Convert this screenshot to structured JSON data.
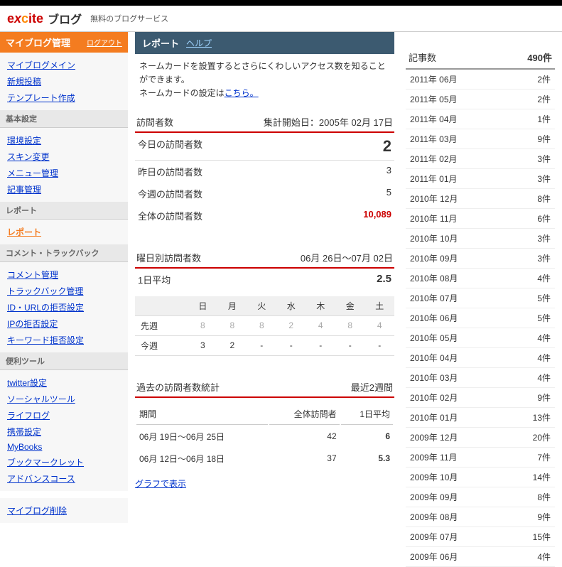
{
  "header": {
    "logo_prefix": "e",
    "logo_x": "x",
    "logo_c": "c",
    "logo_suffix": "ite",
    "logo_blog": "ブログ",
    "tagline": "無料のブログサービス"
  },
  "sidebar": {
    "title": "マイブログ管理",
    "logout": "ログアウト",
    "main_links": [
      "マイブログメイン",
      "新規投稿",
      "テンプレート作成"
    ],
    "sections": [
      {
        "title": "基本設定",
        "links": [
          "環境設定",
          "スキン変更",
          "メニュー管理",
          "記事管理"
        ]
      },
      {
        "title": "レポート",
        "links": [
          "レポート"
        ],
        "current": 0
      },
      {
        "title": "コメント・トラックバック",
        "links": [
          "コメント管理",
          "トラックバック管理",
          "ID・URLの拒否設定",
          "IPの拒否設定",
          "キーワード拒否設定"
        ]
      },
      {
        "title": "便利ツール",
        "links": [
          "twitter設定",
          "ソーシャルツール",
          "ライフログ",
          "携帯設定",
          "MyBooks",
          "ブックマークレット",
          "アドバンスコース"
        ]
      }
    ],
    "delete_link": "マイブログ削除"
  },
  "report": {
    "title": "レポート",
    "help": "ヘルプ",
    "intro_line1": "ネームカードを設置するとさらにくわしいアクセス数を知ることができます。",
    "intro_line2_pre": "ネームカードの設定は",
    "intro_link": "こちら。",
    "visitors": {
      "label": "訪問者数",
      "start_date": "集計開始日：2005年 02月 17日",
      "today_label": "今日の訪問者数",
      "today_value": "2",
      "rows": [
        {
          "label": "昨日の訪問者数",
          "value": "3"
        },
        {
          "label": "今週の訪問者数",
          "value": "5"
        },
        {
          "label": "全体の訪問者数",
          "value": "10,089",
          "red": true
        }
      ]
    },
    "weekday": {
      "label": "曜日別訪問者数",
      "range": "06月 26日〜07月 02日",
      "avg_label": "1日平均",
      "avg_value": "2.5",
      "headers": [
        "日",
        "月",
        "火",
        "水",
        "木",
        "金",
        "土"
      ],
      "rows": [
        {
          "label": "先週",
          "values": [
            "8",
            "8",
            "8",
            "2",
            "4",
            "8",
            "4"
          ],
          "dim": true
        },
        {
          "label": "今週",
          "values": [
            "3",
            "2",
            "-",
            "-",
            "-",
            "-",
            "-"
          ]
        }
      ]
    },
    "past": {
      "label": "過去の訪問者数統計",
      "range": "最近2週間",
      "cols": [
        "期間",
        "全体訪問者",
        "1日平均"
      ],
      "rows": [
        {
          "period": "06月 19日〜06月 25日",
          "total": "42",
          "avg": "6"
        },
        {
          "period": "06月 12日〜06月 18日",
          "total": "37",
          "avg": "5.3"
        }
      ],
      "graph_link": "グラフで表示"
    }
  },
  "archive": {
    "label": "記事数",
    "total": "490件",
    "rows": [
      {
        "month": "2011年 06月",
        "count": "2件"
      },
      {
        "month": "2011年 05月",
        "count": "2件"
      },
      {
        "month": "2011年 04月",
        "count": "1件"
      },
      {
        "month": "2011年 03月",
        "count": "9件"
      },
      {
        "month": "2011年 02月",
        "count": "3件"
      },
      {
        "month": "2011年 01月",
        "count": "3件"
      },
      {
        "month": "2010年 12月",
        "count": "8件"
      },
      {
        "month": "2010年 11月",
        "count": "6件"
      },
      {
        "month": "2010年 10月",
        "count": "3件"
      },
      {
        "month": "2010年 09月",
        "count": "3件"
      },
      {
        "month": "2010年 08月",
        "count": "4件"
      },
      {
        "month": "2010年 07月",
        "count": "5件"
      },
      {
        "month": "2010年 06月",
        "count": "5件"
      },
      {
        "month": "2010年 05月",
        "count": "4件"
      },
      {
        "month": "2010年 04月",
        "count": "4件"
      },
      {
        "month": "2010年 03月",
        "count": "4件"
      },
      {
        "month": "2010年 02月",
        "count": "9件"
      },
      {
        "month": "2010年 01月",
        "count": "13件"
      },
      {
        "month": "2009年 12月",
        "count": "20件"
      },
      {
        "month": "2009年 11月",
        "count": "7件"
      },
      {
        "month": "2009年 10月",
        "count": "14件"
      },
      {
        "month": "2009年 09月",
        "count": "8件"
      },
      {
        "month": "2009年 08月",
        "count": "9件"
      },
      {
        "month": "2009年 07月",
        "count": "15件"
      },
      {
        "month": "2009年 06月",
        "count": "4件"
      }
    ]
  }
}
